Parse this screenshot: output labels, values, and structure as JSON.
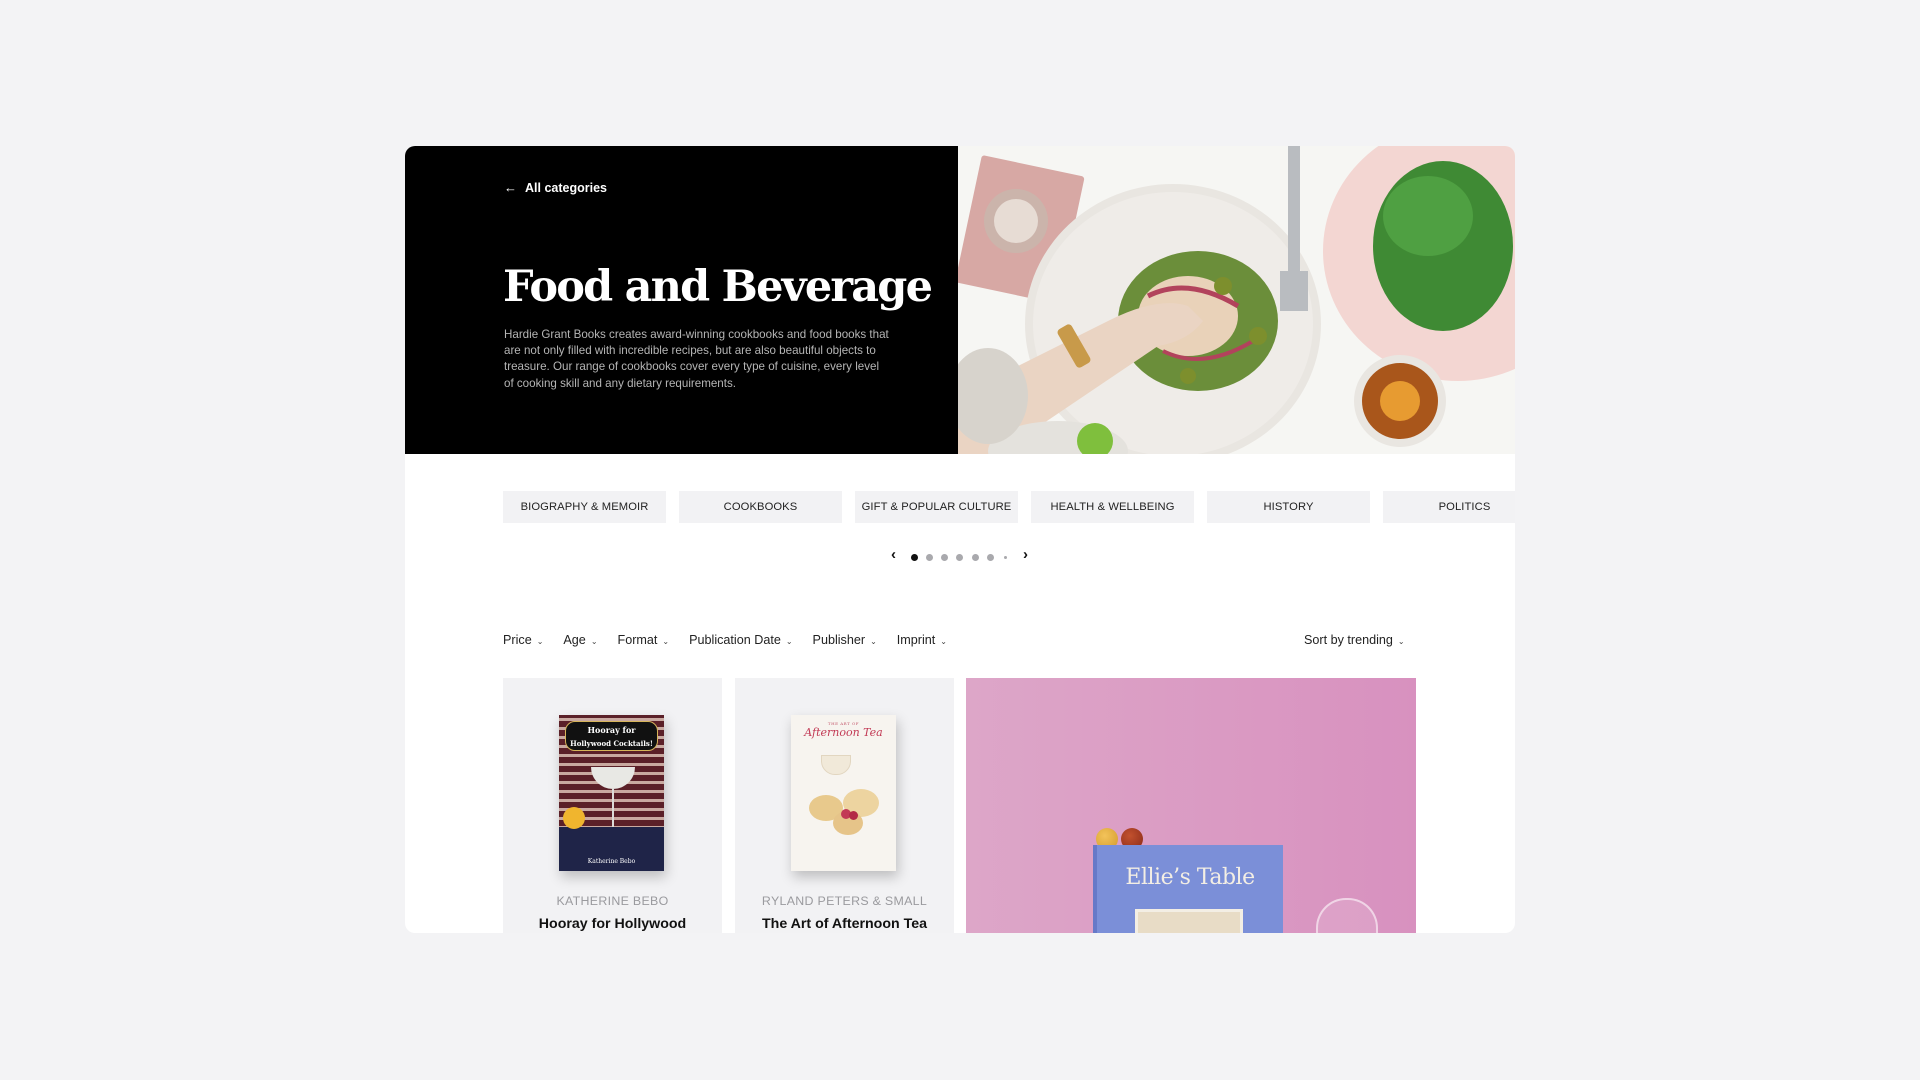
{
  "hero": {
    "back_link": "All categories",
    "back_icon": "arrow-left-icon",
    "title": "Food and Beverage",
    "description": "Hardie Grant Books creates award-winning cookbooks and food books that are not only filled with incredible recipes, but are also beautiful objects to treasure. Our range of cookbooks cover every type of cuisine, every level of cooking skill and any dietary requirements.",
    "image_alt": "Overhead photo of a hand reaching into a plate of fish salad with herbs, olives and red onion, with drinks and a pink plate of greens"
  },
  "categories": [
    {
      "label": "BIOGRAPHY & MEMOIR"
    },
    {
      "label": "COOKBOOKS"
    },
    {
      "label": "GIFT & POPULAR CULTURE"
    },
    {
      "label": "HEALTH & WELLBEING"
    },
    {
      "label": "HISTORY"
    },
    {
      "label": "POLITICS"
    }
  ],
  "carousel": {
    "prev_icon": "chevron-left-icon",
    "next_icon": "chevron-right-icon",
    "prev_label": "‹",
    "next_label": "›",
    "page_count": 7,
    "active_page": 1
  },
  "filters": [
    {
      "label": "Price"
    },
    {
      "label": "Age"
    },
    {
      "label": "Format"
    },
    {
      "label": "Publication Date"
    },
    {
      "label": "Publisher"
    },
    {
      "label": "Imprint"
    }
  ],
  "sort": {
    "label": "Sort by trending"
  },
  "chevron_down": "⌄",
  "products": [
    {
      "author": "KATHERINE BEBO",
      "title": "Hooray for Hollywood Cocktails!",
      "cover_title_line1": "Hooray for",
      "cover_title_line2": "Hollywood Cocktails!",
      "cover_author": "Katherine Bebo"
    },
    {
      "author": "RYLAND PETERS & SMALL",
      "title": "The Art of Afternoon Tea",
      "cover_title_line1": "THE ART OF",
      "cover_title_line2": "Afternoon Tea"
    }
  ],
  "featured": {
    "book_title": "Ellie’s Table",
    "colors": {
      "background": "#d99cc4",
      "book": "#7b8fd8"
    }
  }
}
